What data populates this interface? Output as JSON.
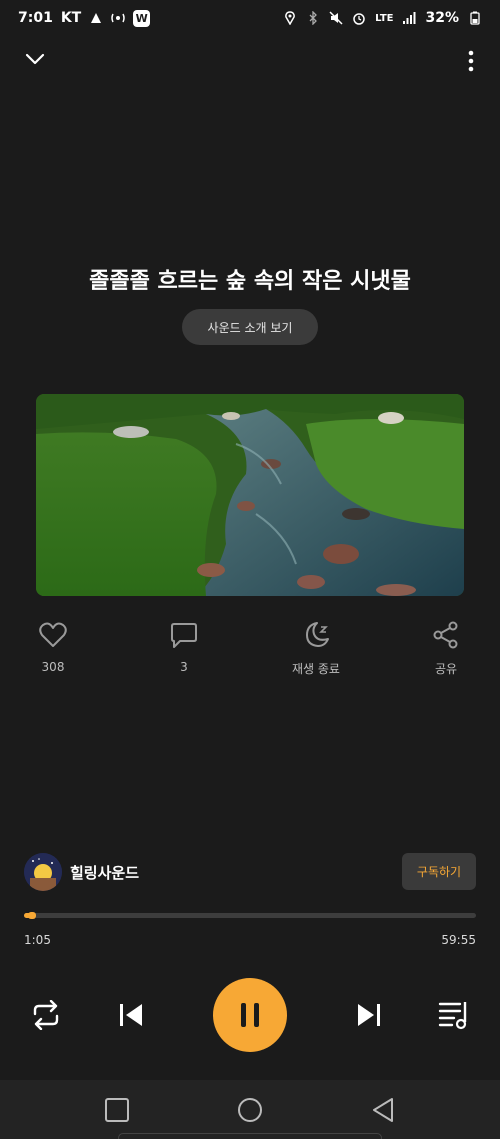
{
  "status_bar": {
    "time": "7:01",
    "carrier": "KT",
    "badge": "W",
    "network": "LTE",
    "battery": "32%"
  },
  "player": {
    "title": "졸졸졸 흐르는 숲 속의 작은 시냇물",
    "intro_button": "사운드 소개 보기",
    "actions": [
      {
        "icon": "heart-icon",
        "label": "308"
      },
      {
        "icon": "comment-icon",
        "label": "3"
      },
      {
        "icon": "sleep-timer-icon",
        "label": "재생 종료"
      },
      {
        "icon": "share-icon",
        "label": "공유"
      }
    ],
    "channel_name": "힐링사운드",
    "subscribe_label": "구독하기",
    "current_time": "1:05",
    "duration": "59:55",
    "progress_fraction": 0.018
  },
  "colors": {
    "accent": "#f7a835",
    "background": "#1b1b1b",
    "button_bg": "#3b3b3b"
  }
}
